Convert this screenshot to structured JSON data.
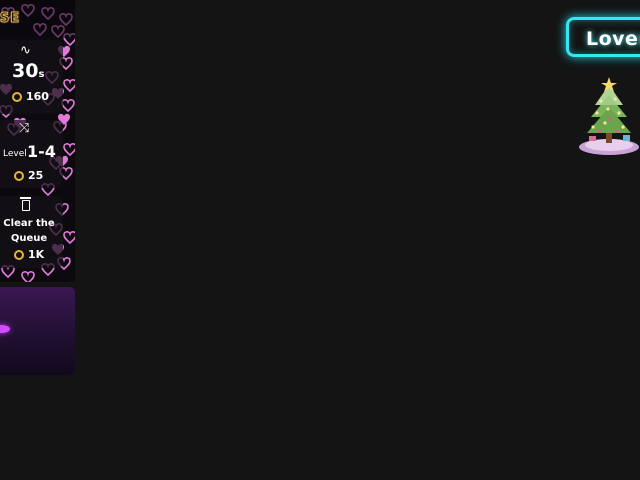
{
  "sidebar": {
    "brand_text": "JSE",
    "cards": [
      {
        "icon": "wave-icon",
        "value": "30",
        "unit": "s",
        "price": "160"
      },
      {
        "icon": "shuffle-icon",
        "label": "Level",
        "value": "1-4",
        "price": "25"
      },
      {
        "icon": "trash-icon",
        "label": "Clear the Queue",
        "price": "1K"
      }
    ]
  },
  "neon_button": {
    "label": "Lover"
  },
  "colors": {
    "accent_cyan": "#37e6f0",
    "heart_pink": "#e07ad8",
    "coin_gold": "#e8b43a",
    "background": "#141414"
  }
}
